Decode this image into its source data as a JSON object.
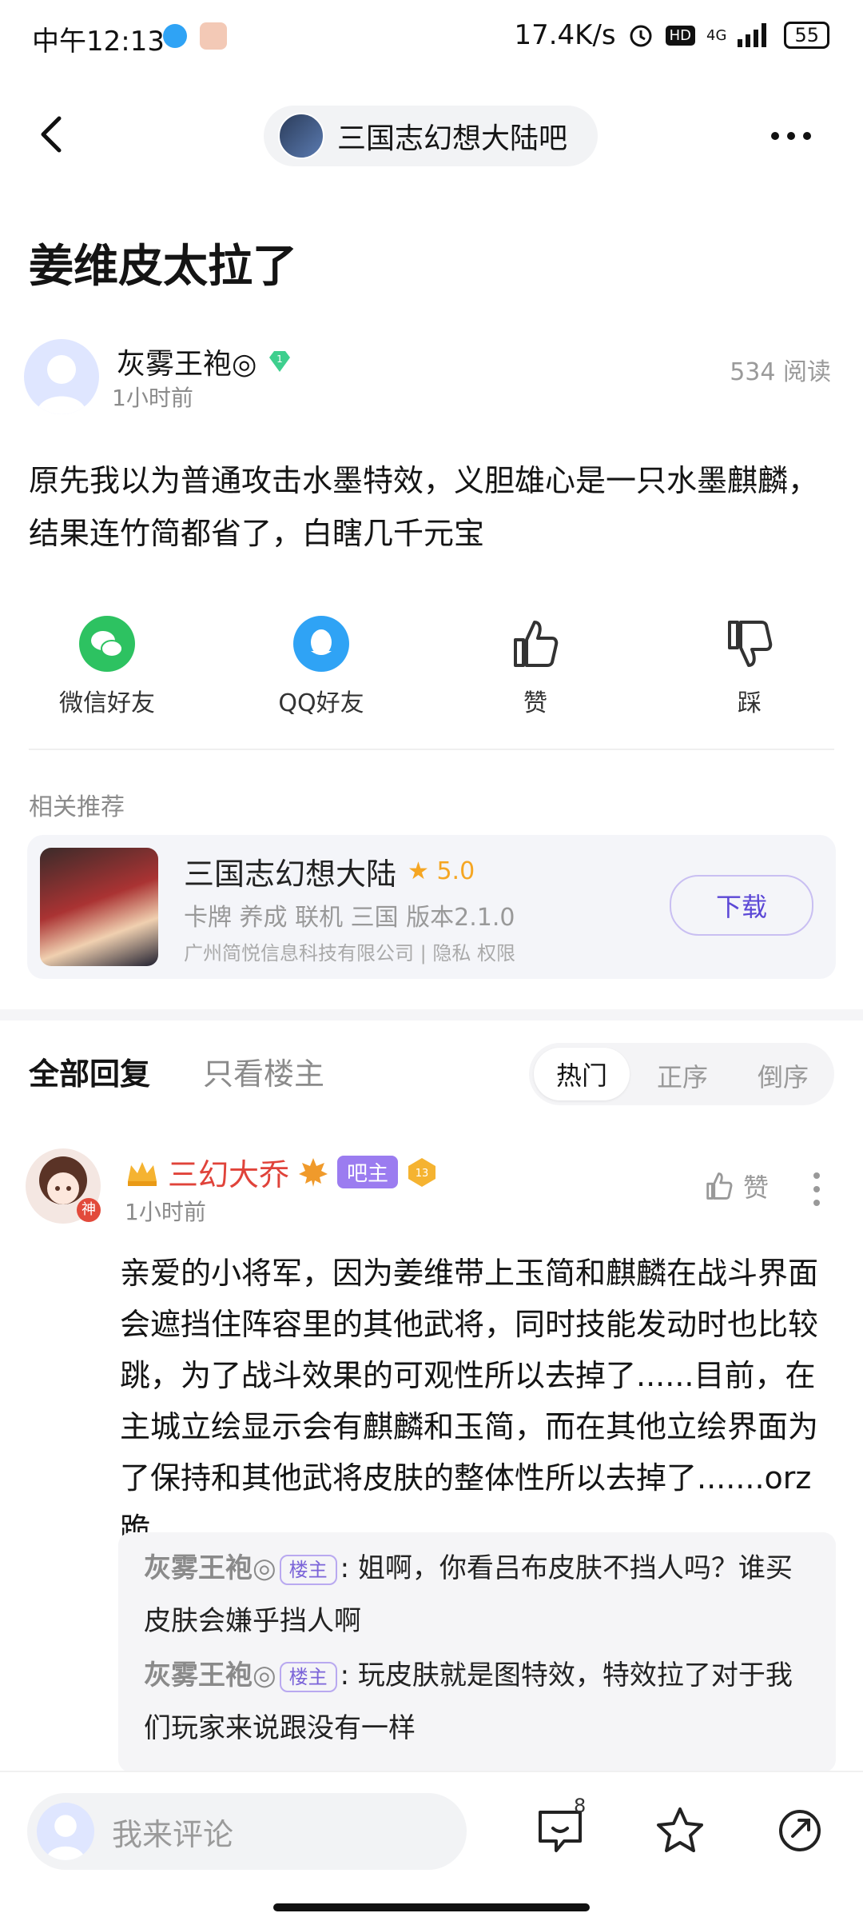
{
  "status_bar": {
    "time": "中午12:13",
    "network_speed": "17.4K/s",
    "hd": "HD",
    "signal": "4G",
    "battery": "55"
  },
  "header": {
    "forum_name": "三国志幻想大陆吧"
  },
  "post": {
    "title": "姜维皮太拉了",
    "author": "灰雾王袍◎",
    "author_level": "1",
    "time": "1小时前",
    "reads": "534 阅读",
    "body": "原先我以为普通攻击水墨特效，义胆雄心是一只水墨麒麟，结果连竹简都省了，白瞎几千元宝"
  },
  "share": {
    "wechat": "微信好友",
    "qq": "QQ好友",
    "like": "赞",
    "dislike": "踩"
  },
  "related": {
    "label": "相关推荐",
    "app_name": "三国志幻想大陆",
    "rating": "5.0",
    "tags": "卡牌 养成 联机 三国   版本2.1.0",
    "company": "广州简悦信息科技有限公司 | 隐私 权限",
    "download": "下载"
  },
  "replies_header": {
    "all": "全部回复",
    "owner_only": "只看楼主",
    "sort_hot": "热门",
    "sort_asc": "正序",
    "sort_desc": "倒序"
  },
  "reply": {
    "name": "三幻大乔",
    "badge": "吧主",
    "level": "13",
    "god_tag": "神",
    "time": "1小时前",
    "like": "赞",
    "text": "亲爱的小将军，因为姜维带上玉简和麒麟在战斗界面会遮挡住阵容里的其他武将，同时技能发动时也比较跳，为了战斗效果的可观性所以去掉了......目前，在主城立绘显示会有麒麟和玉简，而在其他立绘界面为了保持和其他武将皮肤的整体性所以去掉了.......orz跪",
    "subreplies": [
      {
        "who": "灰雾王袍◎",
        "tag": "楼主",
        "text": ": 姐啊，你看吕布皮肤不挡人吗？谁买皮肤会嫌乎挡人啊"
      },
      {
        "who": "灰雾王袍◎",
        "tag": "楼主",
        "text": ": 玩皮肤就是图特效，特效拉了对于我们玩家来说跟没有一样"
      }
    ]
  },
  "bottom_bar": {
    "placeholder": "我来评论",
    "comment_count": "8"
  },
  "colors": {
    "accent": "#5b47d6",
    "owner_badge": "#9b7cf0",
    "reply_name": "#e0433a",
    "wechat": "#2dc261",
    "qq": "#2fa3f5",
    "rating": "#f5a623"
  }
}
